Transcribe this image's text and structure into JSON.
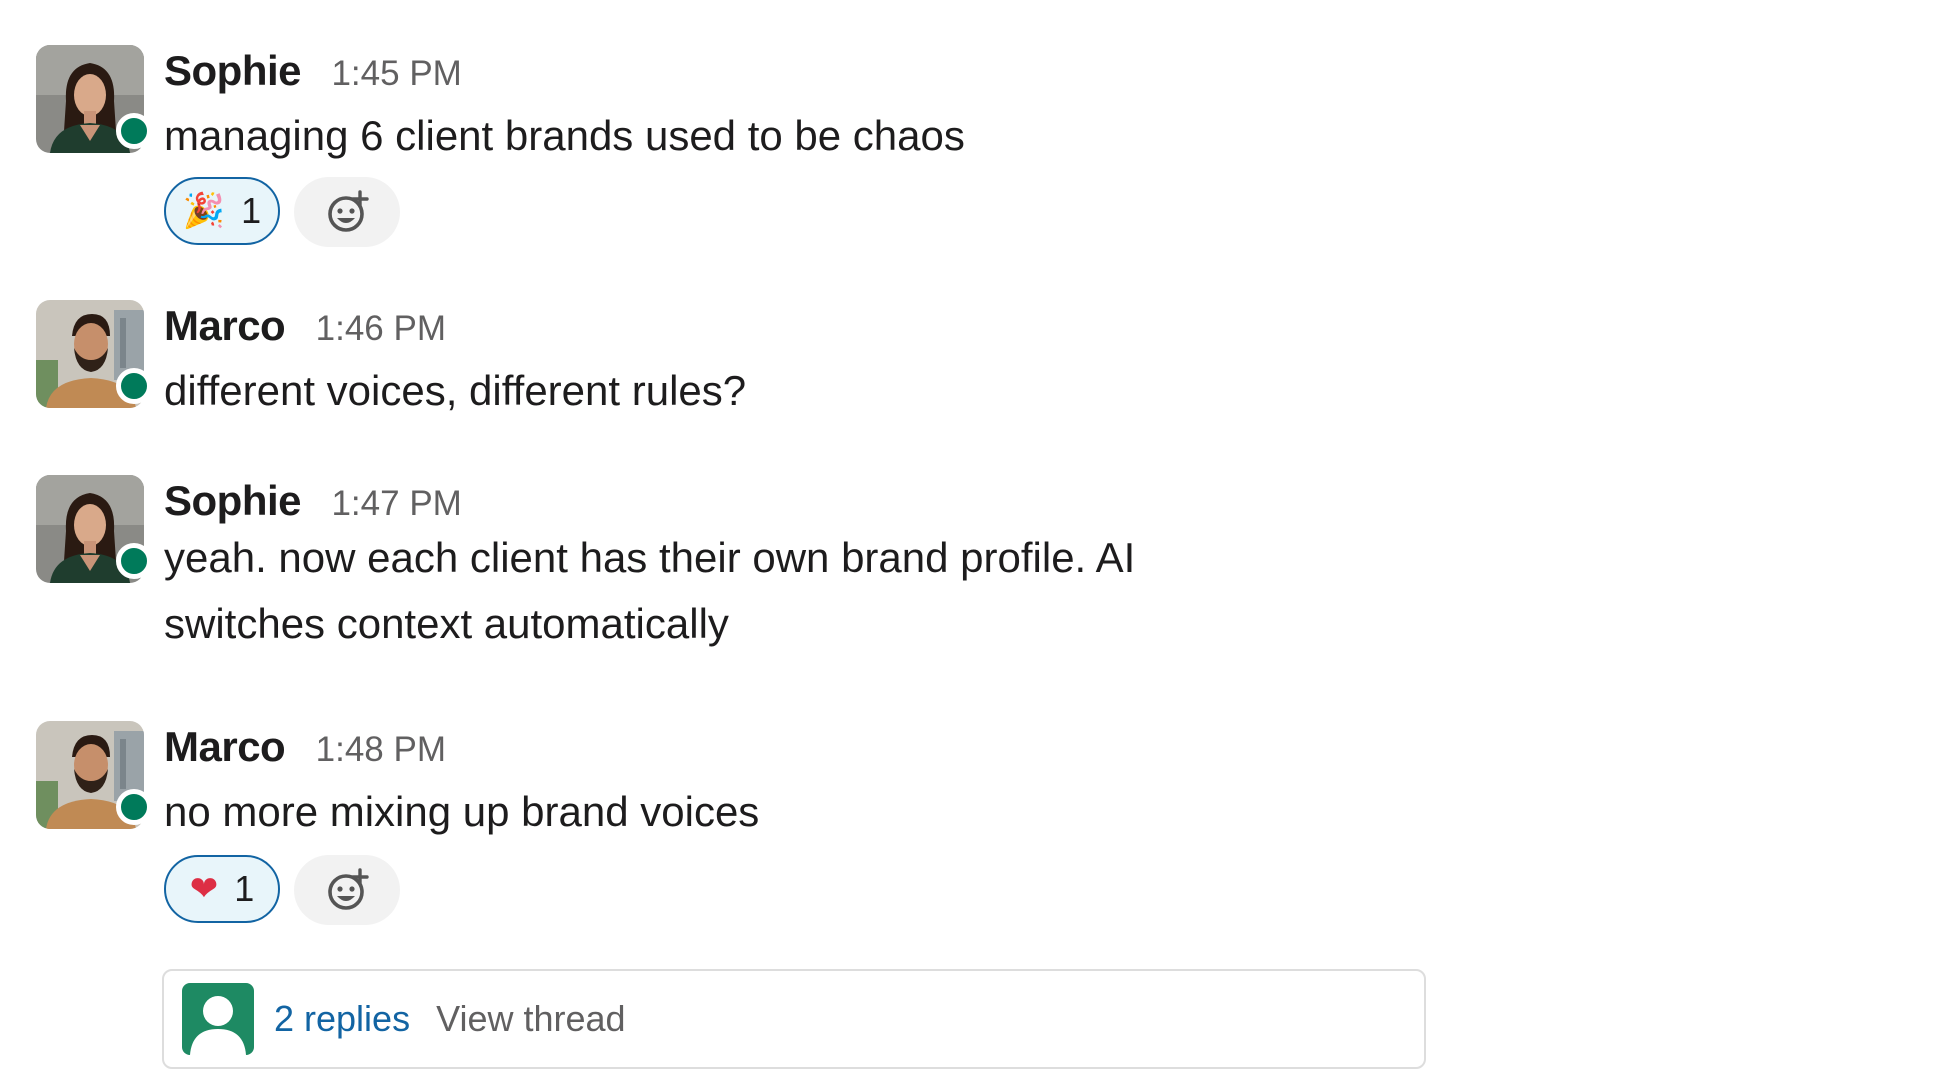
{
  "colors": {
    "presence": "#007a5a",
    "link": "#1264a3",
    "reaction_bg": "#e8f5fa",
    "reaction_border": "#1264a3",
    "timestamp": "#616061"
  },
  "messages": [
    {
      "author": "Sophie",
      "time": "1:45 PM",
      "avatar_icon": "woman-portrait-avatar",
      "lines": [
        "managing 6 client brands used to be chaos"
      ],
      "reactions": [
        {
          "emoji_icon": "party-popper-icon",
          "emoji": "🎉",
          "count": "1"
        }
      ]
    },
    {
      "author": "Marco",
      "time": "1:46 PM",
      "avatar_icon": "man-portrait-avatar",
      "lines": [
        "different voices, different rules?"
      ]
    },
    {
      "author": "Sophie",
      "time": "1:47 PM",
      "avatar_icon": "woman-portrait-avatar",
      "lines": [
        "yeah. now each client has their own brand profile. AI",
        "switches context automatically"
      ]
    },
    {
      "author": "Marco",
      "time": "1:48 PM",
      "avatar_icon": "man-portrait-avatar",
      "lines": [
        "no more mixing up brand voices"
      ],
      "reactions": [
        {
          "emoji_icon": "red-heart-icon",
          "emoji": "❤",
          "count": "1"
        }
      ],
      "thread": {
        "replies": "2 replies",
        "view": "View thread",
        "avatar_icon": "default-user-avatar"
      }
    }
  ]
}
